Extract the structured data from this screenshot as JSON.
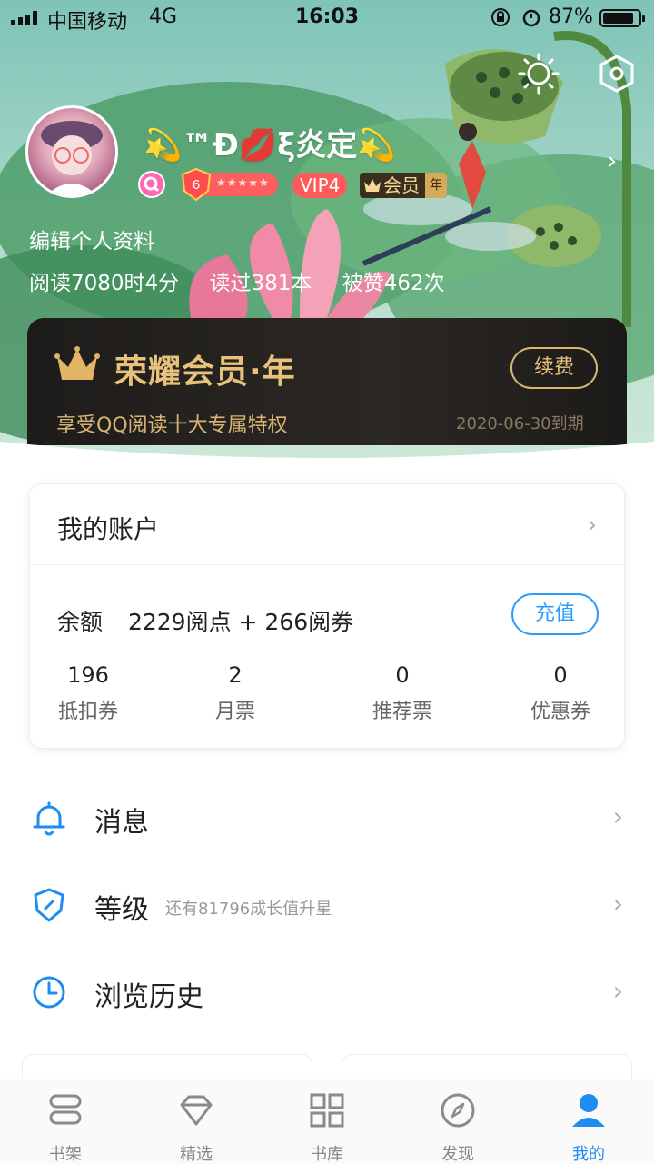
{
  "status_bar": {
    "carrier": "中国移动",
    "network": "4G",
    "time": "16:03",
    "battery_pct": "87%",
    "battery_level": 0.87
  },
  "profile": {
    "nickname": "💫™Đ💋ξ炎定💫",
    "level": "6",
    "vip": "VIP4",
    "member_badge": "会员",
    "member_badge_year": "年",
    "edit_label": "编辑个人资料",
    "stats": [
      "阅读7080时4分",
      "读过381本",
      "被赞462次"
    ]
  },
  "vip_card": {
    "title": "荣耀会员·年",
    "subtitle": "享受QQ阅读十大专属特权",
    "renew_label": "续费",
    "expire": "2020-06-30到期",
    "colors": {
      "gold": "#e8c27a",
      "bg": "#1e1c1a"
    }
  },
  "account": {
    "title": "我的账户",
    "balance_label": "余额",
    "balance_value": "2229阅点 + 266阅券",
    "recharge_label": "充值",
    "stats": [
      {
        "value": "196",
        "label": "抵扣券"
      },
      {
        "value": "2",
        "label": "月票"
      },
      {
        "value": "0",
        "label": "推荐票"
      },
      {
        "value": "0",
        "label": "优惠券"
      }
    ]
  },
  "menu": {
    "messages": {
      "label": "消息",
      "icon": "bell-icon"
    },
    "level": {
      "label": "等级",
      "hint": "还有81796成长值升星",
      "icon": "shield-icon"
    },
    "history": {
      "label": "浏览历史",
      "icon": "clock-icon"
    }
  },
  "tabs": [
    {
      "label": "书架",
      "icon": "bookshelf-icon"
    },
    {
      "label": "精选",
      "icon": "diamond-icon"
    },
    {
      "label": "书库",
      "icon": "grid-icon"
    },
    {
      "label": "发现",
      "icon": "compass-icon"
    },
    {
      "label": "我的",
      "icon": "person-icon",
      "active": true
    }
  ],
  "colors": {
    "accent": "#1e8cf0",
    "recharge": "#2b9cff"
  }
}
